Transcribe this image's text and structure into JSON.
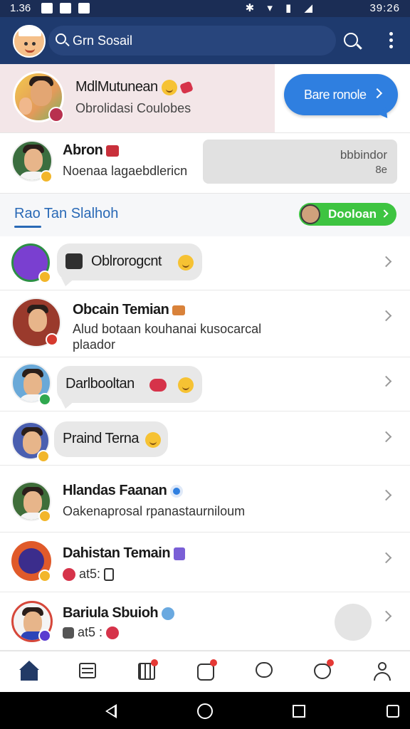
{
  "status_bar": {
    "time": "1.36",
    "right_text": "39:26"
  },
  "app_bar": {
    "search_text": "Grn Sosail"
  },
  "hero": {
    "title": "MdlMutunean",
    "subtitle": "Obrolidasi Coulobes",
    "cta_label": "Bare ronole"
  },
  "featured": {
    "name": "Abron",
    "message": "Noenaa lagaebdlericn",
    "box_line1": "bbbindor",
    "box_line2": "8e"
  },
  "section": {
    "title": "Rao Tan Slalhoh",
    "pill_label": "Dooloan"
  },
  "list": [
    {
      "type": "bubble",
      "text": "Oblrorogcnt"
    },
    {
      "type": "text",
      "title": "Obcain Temian",
      "sub1": "Alud botaan kouhanai kusocarcal",
      "sub2": "plaador"
    },
    {
      "type": "bubble",
      "text": "Darlbooltan"
    },
    {
      "type": "bubble",
      "text": "Praind Terna"
    },
    {
      "type": "text",
      "title": "Hlandas Faanan",
      "sub1": "Oakenaprosal rpanastaurniloum"
    },
    {
      "type": "text",
      "title": "Dahistan Temain",
      "sub1": "at5:"
    },
    {
      "type": "text",
      "title": "Bariula Sbuioh",
      "sub1": "at5 :"
    }
  ],
  "colors": {
    "app_bar": "#1e3a6e",
    "accent_blue": "#2f7fe0",
    "pill_green": "#3ec441",
    "section_title": "#2969b6"
  },
  "bottom_nav_icons": [
    "home-icon",
    "feed-icon",
    "calendar-icon",
    "notifications-icon",
    "chat-icon",
    "likes-icon",
    "profile-icon"
  ]
}
